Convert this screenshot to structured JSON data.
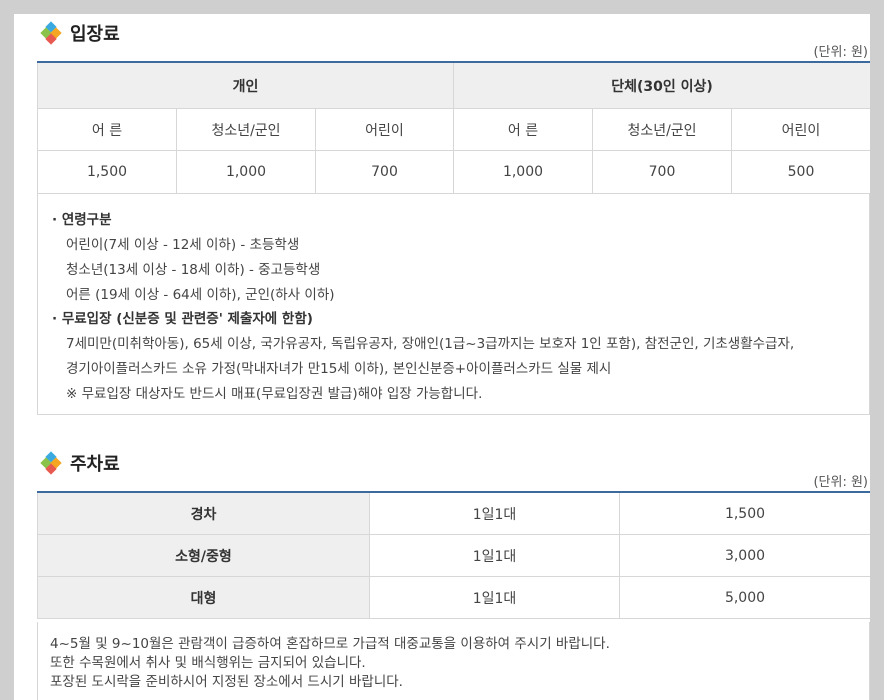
{
  "admission": {
    "title": "입장료",
    "unit": "(단위: 원)",
    "groups": [
      "개인",
      "단체(30인 이상)"
    ],
    "columns": [
      "어 른",
      "청소년/군인",
      "어린이",
      "어 른",
      "청소년/군인",
      "어린이"
    ],
    "prices": [
      "1,500",
      "1,000",
      "700",
      "1,000",
      "700",
      "500"
    ],
    "notes": {
      "age_heading": "· 연령구분",
      "age_lines": [
        "어린이(7세 이상 - 12세 이하) - 초등학생",
        "청소년(13세 이상 - 18세 이하) - 중고등학생",
        "어른 (19세 이상 - 64세 이하), 군인(하사 이하)"
      ],
      "free_heading": "· 무료입장 (신분증 및 관련증' 제출자에 한함)",
      "free_lines": [
        "7세미만(미취학아동), 65세 이상, 국가유공자, 독립유공자, 장애인(1급~3급까지는 보호자 1인 포함), 참전군인, 기초생활수급자,",
        "경기아이플러스카드 소유 가정(막내자녀가 만15세 이하), 본인신분증+아이플러스카드 실물 제시",
        "※ 무료입장 대상자도 반드시 매표(무료입장권 발급)해야 입장 가능합니다."
      ]
    }
  },
  "parking": {
    "title": "주차료",
    "unit": "(단위: 원)",
    "rows": [
      {
        "type": "경차",
        "unit": "1일1대",
        "price": "1,500"
      },
      {
        "type": "소형/중형",
        "unit": "1일1대",
        "price": "3,000"
      },
      {
        "type": "대형",
        "unit": "1일1대",
        "price": "5,000"
      }
    ],
    "footer_lines": [
      "4~5월 및 9~10월은 관람객이 급증하여 혼잡하므로 가급적 대중교통을 이용하여 주시기 바랍니다.",
      "또한 수목원에서 취사 및 배식행위는 금지되어 있습니다.",
      "포장된 도시락을 준비하시어 지정된 장소에서 드시기 바랍니다."
    ]
  }
}
